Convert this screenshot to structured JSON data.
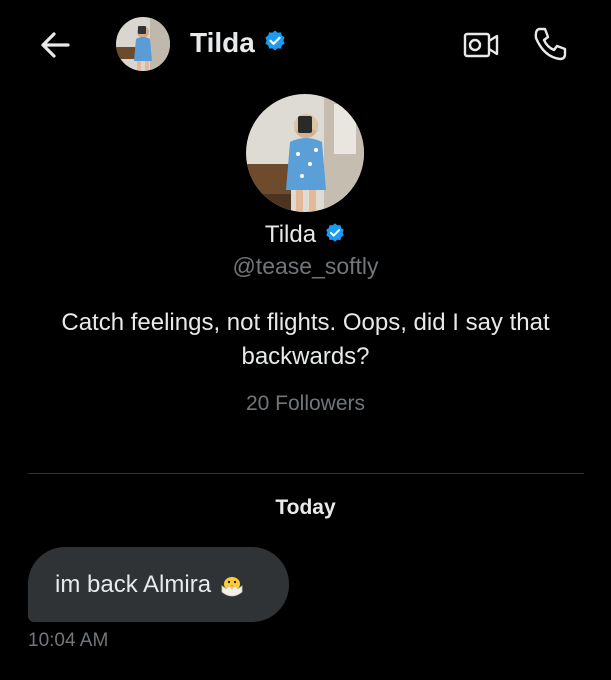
{
  "header": {
    "name": "Tilda",
    "icons": {
      "back": "arrow-left-icon",
      "video": "video-camera-icon",
      "call": "phone-icon",
      "verified": "verified-badge-icon"
    }
  },
  "profile": {
    "name": "Tilda",
    "handle": "@tease_softly",
    "bio": "Catch feelings, not flights. Oops, did I say that backwards?",
    "followers": "20 Followers"
  },
  "conversation": {
    "date_separator": "Today",
    "messages": [
      {
        "text": "im back Almira",
        "emoji": "hatching-chick-icon",
        "time": "10:04 AM"
      }
    ]
  },
  "colors": {
    "background": "#000000",
    "text_primary": "#e7e9ea",
    "text_secondary": "#71767b",
    "bubble": "#2f3336",
    "divider": "#2f3336",
    "verified": "#1d9bf0"
  }
}
